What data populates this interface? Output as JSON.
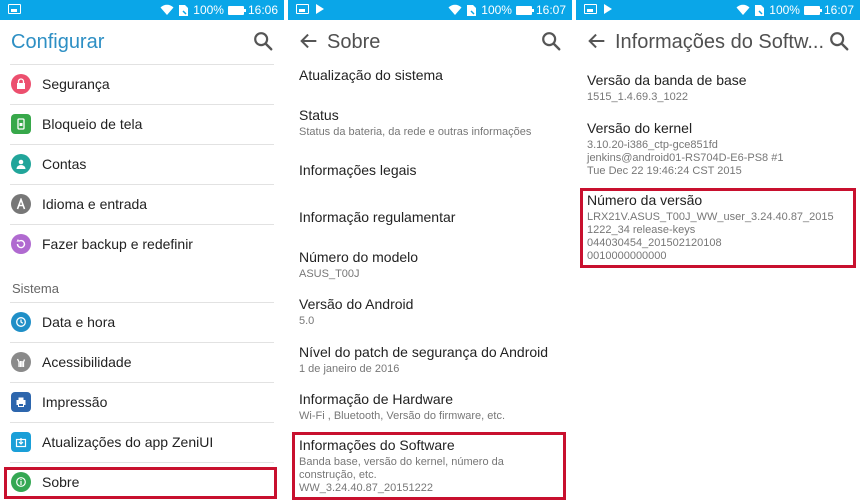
{
  "status_bars": [
    {
      "battery": "100%",
      "time": "16:06"
    },
    {
      "battery": "100%",
      "time": "16:07"
    },
    {
      "battery": "100%",
      "time": "16:07"
    }
  ],
  "colors": {
    "status_bar": "#0aa6e8",
    "title_accent": "#2d8fc4",
    "highlight": "#c8102e"
  },
  "screen1": {
    "title": "Configurar",
    "items": [
      {
        "label": "Segurança",
        "icon": "lock-icon",
        "color": "#ec4f6e"
      },
      {
        "label": "Bloqueio de tela",
        "icon": "lock-screen-icon",
        "color": "#37a84a"
      },
      {
        "label": "Contas",
        "icon": "account-icon",
        "color": "#21a59a"
      },
      {
        "label": "Idioma e entrada",
        "icon": "language-icon",
        "color": "#777777"
      },
      {
        "label": "Fazer backup e redefinir",
        "icon": "backup-icon",
        "color": "#b06ad0"
      }
    ],
    "section_header": "Sistema",
    "system_items": [
      {
        "label": "Data e hora",
        "icon": "clock-icon",
        "color": "#1f8fc7"
      },
      {
        "label": "Acessibilidade",
        "icon": "accessibility-icon",
        "color": "#8a8a8a"
      },
      {
        "label": "Impressão",
        "icon": "printer-icon",
        "color": "#2d66ad"
      },
      {
        "label": "Atualizações do app ZenіUI",
        "icon": "update-icon",
        "color": "#1a9fd8"
      },
      {
        "label": "Sobre",
        "icon": "info-icon",
        "color": "#34a853"
      }
    ]
  },
  "screen2": {
    "title": "Sobre",
    "items": [
      {
        "title": "Atualização do sistema",
        "sub": ""
      },
      {
        "title": "Status",
        "sub": "Status da bateria, da rede e outras informações"
      },
      {
        "title": "Informações legais",
        "sub": ""
      },
      {
        "title": "Informação regulamentar",
        "sub": ""
      },
      {
        "title": "Número do modelo",
        "sub": "ASUS_T00J"
      },
      {
        "title": "Versão do Android",
        "sub": "5.0"
      },
      {
        "title": "Nível do patch de segurança do Android",
        "sub": "1 de janeiro de 2016"
      },
      {
        "title": "Informação de Hardware",
        "sub": "Wi-Fi , Bluetooth, Versão do firmware, etc."
      },
      {
        "title": "Informações do Software",
        "sub": "Banda base, versão do kernel, número da construção, etc.",
        "sub2": "WW_3.24.40.87_20151222"
      }
    ]
  },
  "screen3": {
    "title": "Informações do Softw...",
    "items": [
      {
        "title": "Versão da banda de base",
        "lines": [
          "1515_1.4.69.3_1022"
        ]
      },
      {
        "title": "Versão do kernel",
        "lines": [
          "3.10.20-i386_ctp-gce851fd",
          "jenkins@android01-RS704D-E6-PS8 #1",
          "Tue Dec 22 19:46:24 CST 2015"
        ]
      },
      {
        "title": "Número da versão",
        "lines": [
          "LRX21V.ASUS_T00J_WW_user_3.24.40.87_2015",
          "1222_34 release-keys",
          "044030454_201502120108",
          "0010000000000"
        ]
      }
    ]
  }
}
